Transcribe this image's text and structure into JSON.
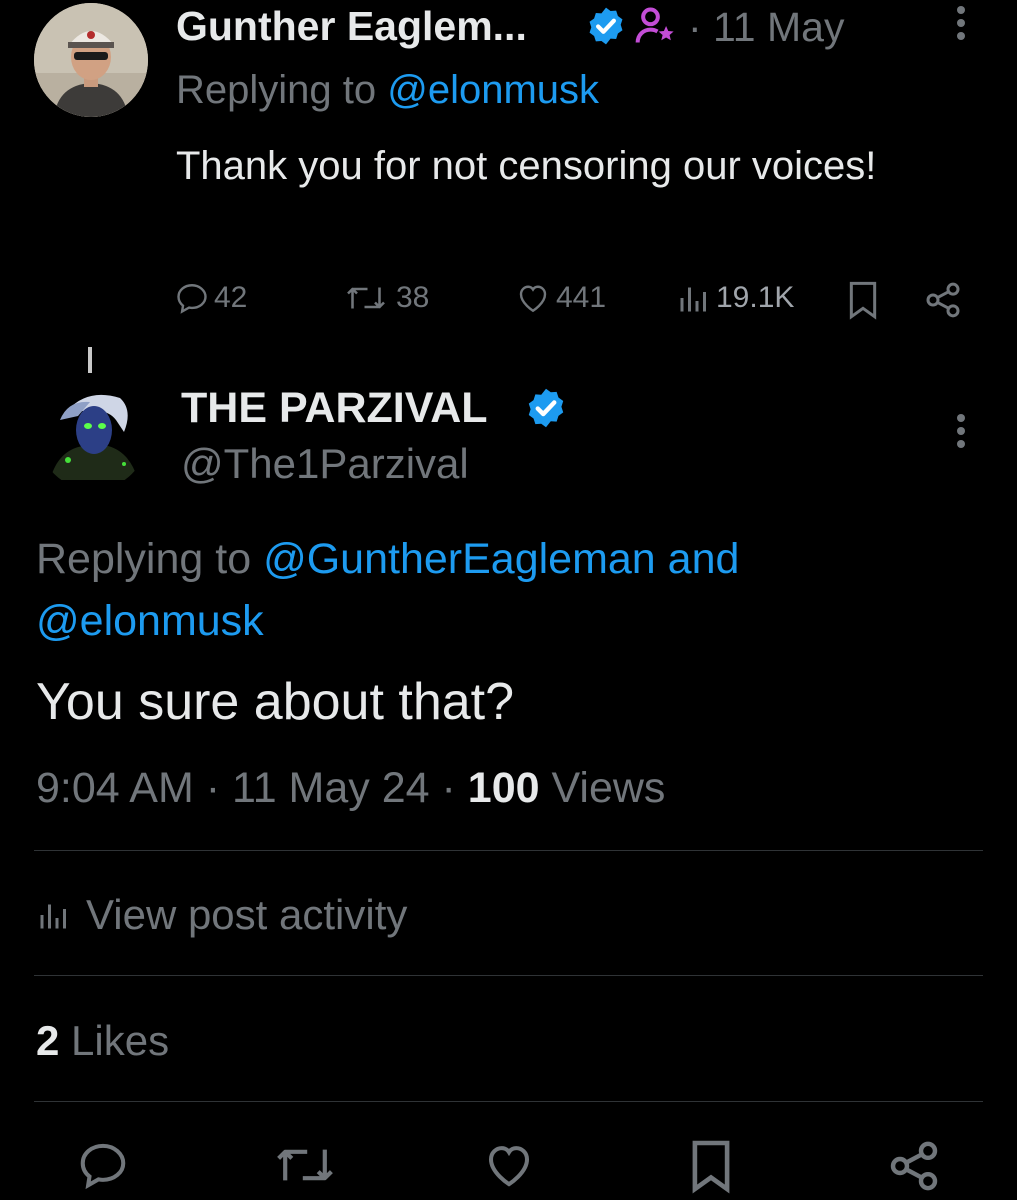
{
  "reply_tweet": {
    "author_name": "Gunther Eaglem...",
    "date": "· 11 May",
    "replying_prefix": "Replying to ",
    "replying_to": "@elonmusk",
    "text": "Thank you for not censoring our voices!",
    "stats": {
      "replies": "42",
      "retweets": "38",
      "likes": "441",
      "views": "19.1K"
    }
  },
  "main_tweet": {
    "author_name": "THE PARZIVAL",
    "handle": "@The1Parzival",
    "replying_prefix": "Replying to ",
    "replying_to": "@GuntherEagleman and @elonmusk",
    "text": "You sure about that?",
    "time": "9:04 AM · 11 May 24 · ",
    "views_count": "100",
    "views_label": " Views",
    "activity_label": "View post activity",
    "likes_count": "2",
    "likes_label": " Likes"
  },
  "colors": {
    "background": "#000000",
    "primary_text": "#e7e9ea",
    "secondary_text": "#71767b",
    "link": "#1d9bf0",
    "verified": "#1d9bf0",
    "badge_purple": "#c34dd6",
    "divider": "#2f3336"
  },
  "icons": {
    "verified": "verified-badge-icon",
    "affiliate": "person-star-icon",
    "more": "more-vertical-icon",
    "reply": "reply-bubble-icon",
    "retweet": "retweet-icon",
    "like": "heart-icon",
    "views": "views-bar-icon",
    "bookmark": "bookmark-icon",
    "share": "share-icon"
  }
}
